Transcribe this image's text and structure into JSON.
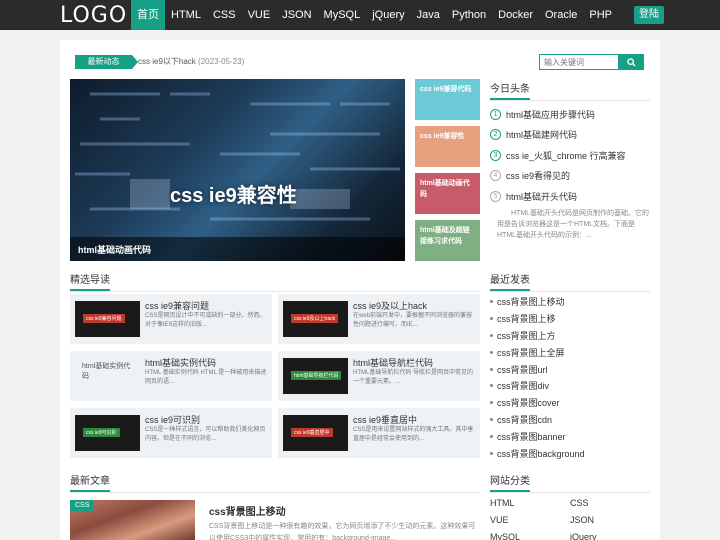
{
  "nav": {
    "logo": "LOGO",
    "items": [
      "首页",
      "HTML",
      "CSS",
      "VUE",
      "JSON",
      "MySQL",
      "jQuery",
      "Java",
      "Python",
      "Docker",
      "Oracle",
      "PHP"
    ],
    "login": "登陆"
  },
  "ticker": {
    "label": "最新动态",
    "text": "css ie9以下hack",
    "date": "(2023-05-23)"
  },
  "search": {
    "placeholder": "输入关键词"
  },
  "hero": {
    "image_title": "css ie9兼容性",
    "caption": "html基础动画代码"
  },
  "tiles": [
    {
      "label": "css ie9兼容代码",
      "color": "#6cc9d6"
    },
    {
      "label": "css ie9兼容性",
      "color": "#e6a07e"
    },
    {
      "label": "html基础动画代码",
      "color": "#c85b6a"
    },
    {
      "label": "html基础及超链接练习求代码",
      "color": "#7fb081"
    }
  ],
  "hot": {
    "title": "今日头条",
    "items": [
      {
        "num": "1",
        "text": "html基础应用步骤代码"
      },
      {
        "num": "2",
        "text": "html基础建网代码"
      },
      {
        "num": "3",
        "text": "css ie_火狐_chrome 行高兼容"
      },
      {
        "num": "4",
        "text": "css ie9看得见的"
      },
      {
        "num": "5",
        "text": "html基础开头代码"
      }
    ],
    "desc": "HTML基础开头代码是网页制作的基础。它的用是告诉浏览器这是一个HTML文档。下面是HTML基础开头代码的示例：..."
  },
  "featured": {
    "title": "精选导读",
    "items": [
      {
        "title": "css ie9兼容问题",
        "desc": "CSS是网页设计中不可或缺的一部分。然而。对于像IE9这样的旧版...",
        "badge": "css ie9兼容问题",
        "badge_color": "#c0392b"
      },
      {
        "title": "css ie9及以上hack",
        "desc": "在web前端开发中，要根据不同浏览器的兼容性问题进行编写。而IE...",
        "badge": "css ie9及以上hack",
        "badge_color": "#c0392b"
      },
      {
        "title": "html基础实例代码",
        "desc": "HTML 基础实例代码 HTML 是一种被用来描述网页的语...",
        "badge": "html基础实例代码",
        "badge_color": ""
      },
      {
        "title": "html基础导航栏代码",
        "desc": "HTML基础导航栏代码 导航栏是网页中常见的一个重要元素。...",
        "badge": "html基础导航栏代码",
        "badge_color": "#2e8b3e"
      },
      {
        "title": "css ie9可识别",
        "desc": "CSS是一种样式语言，可以帮助我们美化网页内容。但是在不同的浏览...",
        "badge": "css ie9可识别",
        "badge_color": "#2e8b3e"
      },
      {
        "title": "css ie9垂直居中",
        "desc": "CSS是用来设置网站样式的强大工具。其中垂直居中是经常会使用到的...",
        "badge": "css ie9垂直居中",
        "badge_color": "#c0392b"
      }
    ]
  },
  "latest_posts": {
    "title": "最近发表",
    "items": [
      "css背景图上移动",
      "css背景图上移",
      "css背景图上方",
      "css背景图上全屏",
      "css背景图url",
      "css背景图div",
      "css背景图cover",
      "css背景图cdn",
      "css背景图banner",
      "css背景图background"
    ]
  },
  "categories": {
    "title": "网站分类",
    "items": [
      "HTML",
      "CSS",
      "VUE",
      "JSON",
      "MySQL",
      "jQuery"
    ]
  },
  "latest_articles": {
    "title": "最新文章",
    "items": [
      {
        "tag": "CSS",
        "title": "css背景图上移动",
        "desc": "CSS背景图上移动是一种很有趣的效果，它为网页增添了不少生动的元素。这种效果可以使用CSS3中的属性实现，常用的有：background-image..."
      }
    ]
  }
}
